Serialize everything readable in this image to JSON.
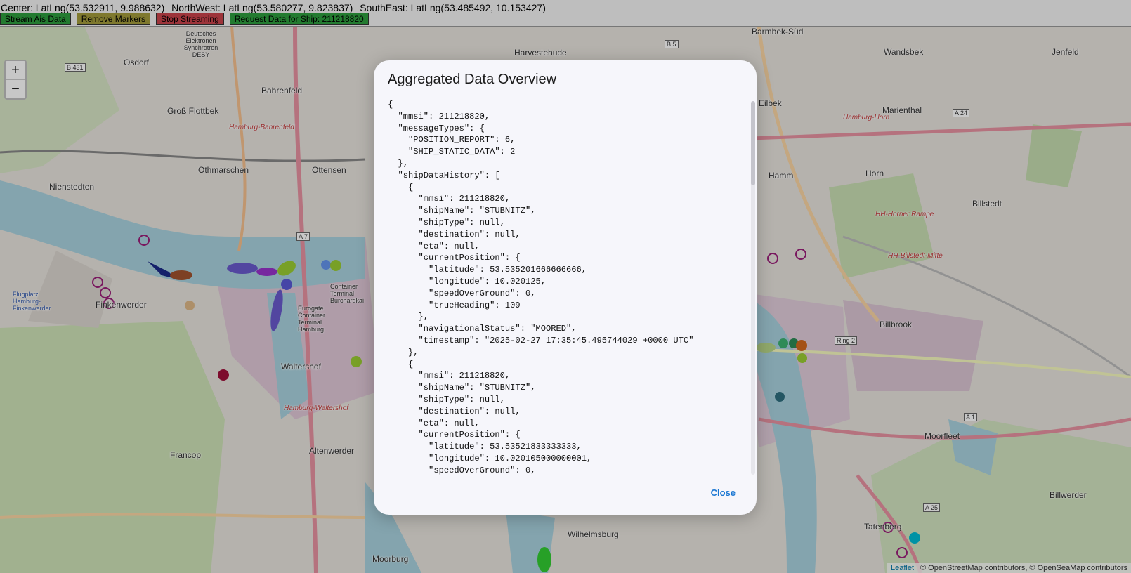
{
  "topbar": {
    "center": "Center: LatLng(53.532911, 9.988632)",
    "northwest": "NorthWest: LatLng(53.580277, 9.823837)",
    "southeast": "SouthEast: LatLng(53.485492, 10.153427)",
    "buttons": [
      {
        "label": "Stream Ais Data",
        "color": "#2e9e3e"
      },
      {
        "label": "Remove Markers",
        "color": "#a39b3c"
      },
      {
        "label": "Stop Streaming",
        "color": "#c9434b"
      },
      {
        "label": "Request Data for Ship: 211218820",
        "color": "#2e9e3e"
      }
    ]
  },
  "map": {
    "zoom_in": "+",
    "zoom_out": "−",
    "attribution": {
      "leaflet": "Leaflet",
      "rest": "| © OpenStreetMap contributors, © OpenSeaMap contributors"
    },
    "places": [
      "Osdorf",
      "Bahrenfeld",
      "Groß Flottbek",
      "Othmarschen",
      "Ottensen",
      "Nienstedten",
      "Finkenwerder",
      "Waltershof",
      "Francop",
      "Altenwerder",
      "Moorburg",
      "Wilhelmsburg",
      "Barmbek-Süd",
      "Wandsbek",
      "Jenfeld",
      "Harvestehude",
      "Marienthal",
      "Hamm",
      "Horn",
      "Billstedt",
      "Billbrook",
      "Moorfleet",
      "Billwerder",
      "Tatenberg",
      "Eilbek",
      "Hamburg-Bahrenfeld",
      "Hamburg-Horn",
      "HH-Horner Rampe",
      "HH-Billstedt-Mitte",
      "Hamburg-Waltershof",
      "Ring 2",
      "A 7",
      "A 24",
      "A 1",
      "A 25",
      "B 431",
      "B 5",
      "Deutsches Elektronen Synchrotron DESY",
      "Eurogate Container Terminal Hamburg",
      "Container Terminal Burchardkai",
      "Flugplatz Hamburg-Finkenwerder"
    ]
  },
  "modal": {
    "title": "Aggregated Data Overview",
    "close_label": "Close",
    "json_lines": [
      "{",
      "  \"mmsi\": 211218820,",
      "  \"messageTypes\": {",
      "    \"POSITION_REPORT\": 6,",
      "    \"SHIP_STATIC_DATA\": 2",
      "  },",
      "  \"shipDataHistory\": [",
      "    {",
      "      \"mmsi\": 211218820,",
      "      \"shipName\": \"STUBNITZ\",",
      "      \"shipType\": null,",
      "      \"destination\": null,",
      "      \"eta\": null,",
      "      \"currentPosition\": {",
      "        \"latitude\": 53.535201666666666,",
      "        \"longitude\": 10.020125,",
      "        \"speedOverGround\": 0,",
      "        \"trueHeading\": 109",
      "      },",
      "      \"navigationalStatus\": \"MOORED\",",
      "      \"timestamp\": \"2025-02-27 17:35:45.495744029 +0000 UTC\"",
      "    },",
      "    {",
      "      \"mmsi\": 211218820,",
      "      \"shipName\": \"STUBNITZ\",",
      "      \"shipType\": null,",
      "      \"destination\": null,",
      "      \"eta\": null,",
      "      \"currentPosition\": {",
      "        \"latitude\": 53.53521833333333,",
      "        \"longitude\": 10.020105000000001,",
      "        \"speedOverGround\": 0,"
    ]
  }
}
